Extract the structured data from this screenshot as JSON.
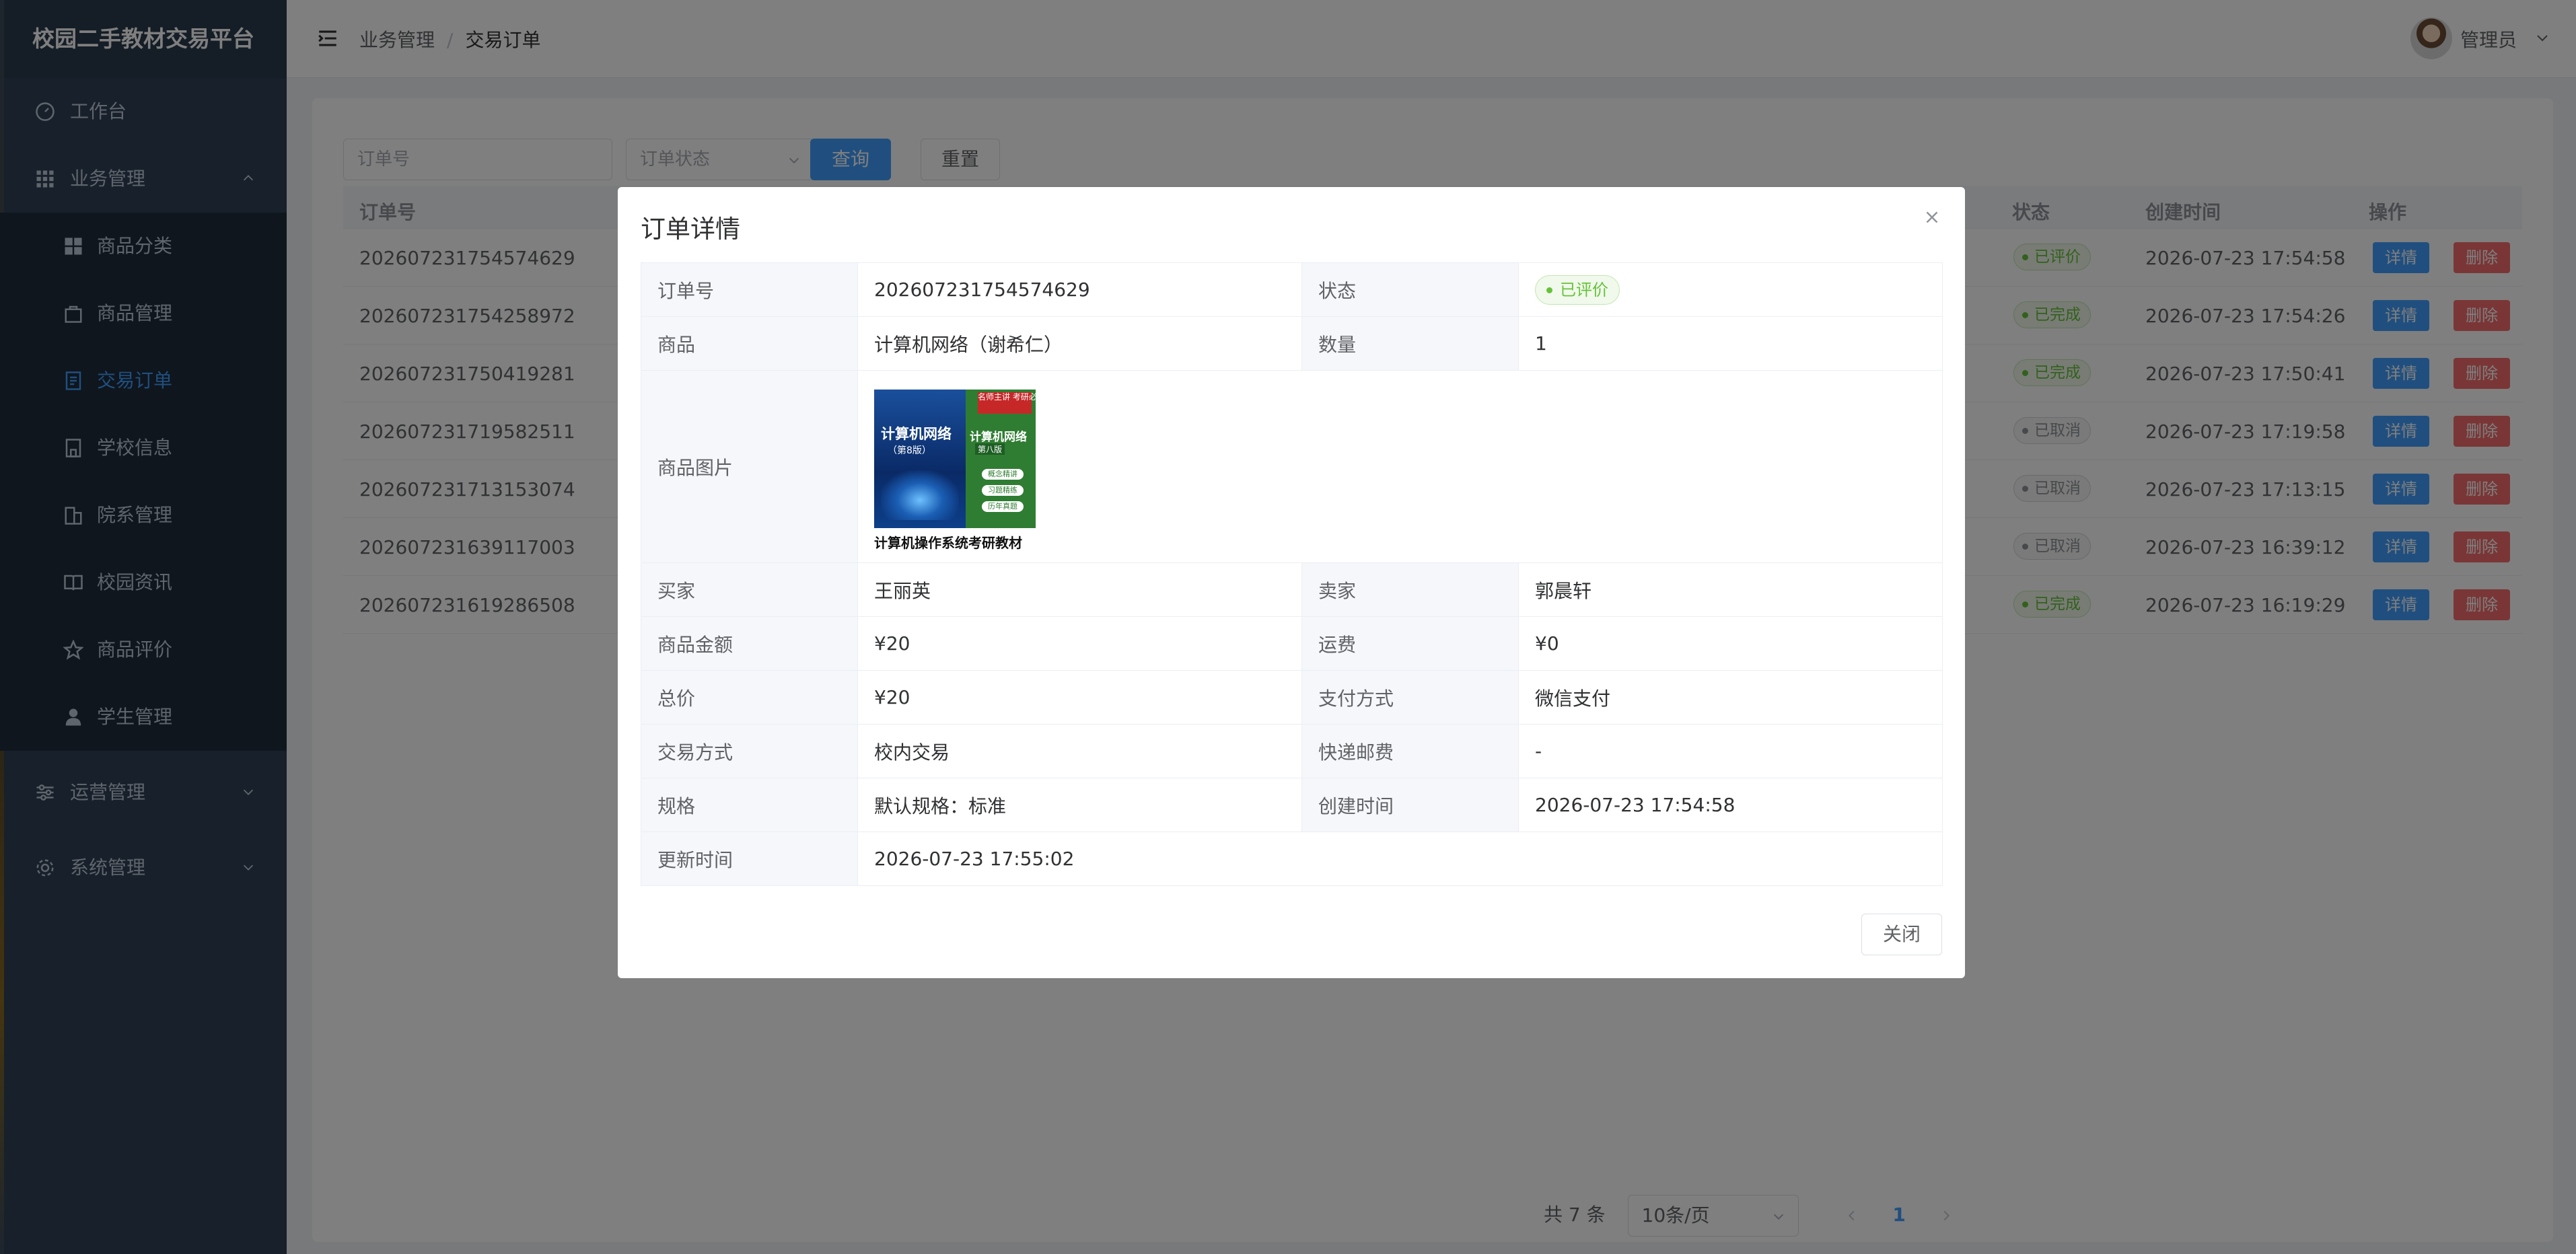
{
  "app": {
    "title": "校园二手教材交易平台"
  },
  "sidebar": {
    "items": [
      {
        "label": "工作台",
        "icon": "dashboard-icon"
      },
      {
        "label": "业务管理",
        "icon": "grid-icon",
        "expanded": true
      },
      {
        "label": "商品分类",
        "icon": "category-icon"
      },
      {
        "label": "商品管理",
        "icon": "bag-icon"
      },
      {
        "label": "交易订单",
        "icon": "document-icon",
        "active": true
      },
      {
        "label": "学校信息",
        "icon": "school-icon"
      },
      {
        "label": "院系管理",
        "icon": "building-icon"
      },
      {
        "label": "校园资讯",
        "icon": "book-icon"
      },
      {
        "label": "商品评价",
        "icon": "star-icon"
      },
      {
        "label": "学生管理",
        "icon": "user-icon"
      },
      {
        "label": "运营管理",
        "icon": "sliders-icon",
        "expanded": false
      },
      {
        "label": "系统管理",
        "icon": "gear-icon",
        "expanded": false
      }
    ]
  },
  "header": {
    "breadcrumb": [
      "业务管理",
      "交易订单"
    ],
    "user_name": "管理员"
  },
  "search": {
    "order_no_placeholder": "订单号",
    "status_placeholder": "订单状态",
    "query_label": "查询",
    "reset_label": "重置"
  },
  "table": {
    "columns": {
      "order_no": "订单号",
      "status": "状态",
      "created": "创建时间",
      "actions": "操作"
    },
    "detail_label": "详情",
    "delete_label": "删除",
    "rows": [
      {
        "order_no": "202607231754574629",
        "status": "已评价",
        "status_color": "green",
        "created": "2026-07-23 17:54:58"
      },
      {
        "order_no": "202607231754258972",
        "status": "已完成",
        "status_color": "green",
        "created": "2026-07-23 17:54:26"
      },
      {
        "order_no": "202607231750419281",
        "status": "已完成",
        "status_color": "green",
        "created": "2026-07-23 17:50:41"
      },
      {
        "order_no": "202607231719582511",
        "status": "已取消",
        "status_color": "gray",
        "created": "2026-07-23 17:19:58"
      },
      {
        "order_no": "202607231713153074",
        "status": "已取消",
        "status_color": "gray",
        "created": "2026-07-23 17:13:15"
      },
      {
        "order_no": "202607231639117003",
        "status": "已取消",
        "status_color": "gray",
        "created": "2026-07-23 16:39:12"
      },
      {
        "order_no": "202607231619286508",
        "status": "已完成",
        "status_color": "green",
        "created": "2026-07-23 16:19:29"
      }
    ]
  },
  "pagination": {
    "total": "共 7 条",
    "page_size": "10条/页",
    "current": "1"
  },
  "dialog": {
    "title": "订单详情",
    "labels": {
      "order_no": "订单号",
      "status": "状态",
      "product": "商品",
      "quantity": "数量",
      "image": "商品图片",
      "buyer": "买家",
      "seller": "卖家",
      "amount": "商品金额",
      "shipping": "运费",
      "total": "总价",
      "payment": "支付方式",
      "trade_method": "交易方式",
      "express_fee": "快递邮费",
      "spec": "规格",
      "created": "创建时间",
      "updated": "更新时间"
    },
    "values": {
      "order_no": "202607231754574629",
      "status": "已评价",
      "product": "计算机网络（谢希仁）",
      "quantity": "1",
      "buyer": "王丽英",
      "seller": "郭晨轩",
      "amount": "¥20",
      "shipping": "¥0",
      "total": "¥20",
      "payment": "微信支付",
      "trade_method": "校内交易",
      "express_fee": "-",
      "spec": "默认规格：标准",
      "created": "2026-07-23 17:54:58",
      "updated": "2026-07-23 17:55:02"
    },
    "book_cover": {
      "left_title": "计算机网络",
      "left_sub": "（第8版）",
      "right_title": "计算机网络",
      "right_sub": "第八版",
      "stamp": "名师主讲 考研必备",
      "badges": [
        "概念精讲",
        "习题精练",
        "历年真题"
      ],
      "caption": "计算机操作系统考研教材"
    },
    "close_label": "关闭"
  },
  "colors": {
    "primary": "#409eff",
    "danger": "#f56c6c",
    "success": "#67c23a",
    "sidebar_bg": "#304156"
  }
}
